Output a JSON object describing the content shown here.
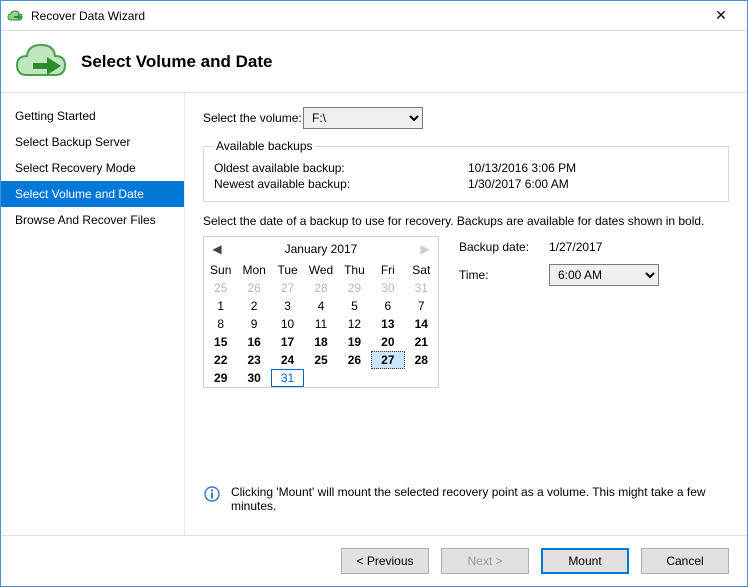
{
  "window": {
    "title": "Recover Data Wizard"
  },
  "header": {
    "title": "Select Volume and Date"
  },
  "sidebar": {
    "steps": [
      {
        "label": "Getting Started"
      },
      {
        "label": "Select Backup Server"
      },
      {
        "label": "Select Recovery Mode"
      },
      {
        "label": "Select Volume and Date"
      },
      {
        "label": "Browse And Recover Files"
      }
    ],
    "active_index": 3
  },
  "main": {
    "select_volume_label": "Select the volume:",
    "volume_selected": "F:\\",
    "group_legend": "Available backups",
    "oldest_label": "Oldest available backup:",
    "oldest_value": "10/13/2016 3:06 PM",
    "newest_label": "Newest available backup:",
    "newest_value": "1/30/2017 6:00 AM",
    "instruction": "Select the date of a backup to use for recovery. Backups are available for dates shown in bold.",
    "backup_date_label": "Backup date:",
    "backup_date_value": "1/27/2017",
    "time_label": "Time:",
    "time_value": "6:00 AM",
    "info_text": "Clicking 'Mount' will mount the selected recovery point as a volume. This might take a few minutes."
  },
  "calendar": {
    "month_label": "January 2017",
    "dow": [
      "Sun",
      "Mon",
      "Tue",
      "Wed",
      "Thu",
      "Fri",
      "Sat"
    ],
    "selected_day": 27,
    "today_day": 31,
    "cells": [
      {
        "n": 25,
        "other": true
      },
      {
        "n": 26,
        "other": true
      },
      {
        "n": 27,
        "other": true
      },
      {
        "n": 28,
        "other": true
      },
      {
        "n": 29,
        "other": true
      },
      {
        "n": 30,
        "other": true
      },
      {
        "n": 31,
        "other": true
      },
      {
        "n": 1
      },
      {
        "n": 2
      },
      {
        "n": 3
      },
      {
        "n": 4
      },
      {
        "n": 5
      },
      {
        "n": 6
      },
      {
        "n": 7
      },
      {
        "n": 8
      },
      {
        "n": 9
      },
      {
        "n": 10
      },
      {
        "n": 11
      },
      {
        "n": 12
      },
      {
        "n": 13,
        "bold": true
      },
      {
        "n": 14,
        "bold": true
      },
      {
        "n": 15,
        "bold": true
      },
      {
        "n": 16,
        "bold": true
      },
      {
        "n": 17,
        "bold": true
      },
      {
        "n": 18,
        "bold": true
      },
      {
        "n": 19,
        "bold": true
      },
      {
        "n": 20,
        "bold": true
      },
      {
        "n": 21,
        "bold": true
      },
      {
        "n": 22,
        "bold": true
      },
      {
        "n": 23,
        "bold": true
      },
      {
        "n": 24,
        "bold": true
      },
      {
        "n": 25,
        "bold": true
      },
      {
        "n": 26,
        "bold": true
      },
      {
        "n": 27,
        "bold": true
      },
      {
        "n": 28,
        "bold": true
      },
      {
        "n": 29,
        "bold": true
      },
      {
        "n": 30,
        "bold": true
      },
      {
        "n": 31
      }
    ]
  },
  "footer": {
    "previous": "< Previous",
    "next": "Next >",
    "mount": "Mount",
    "cancel": "Cancel"
  }
}
